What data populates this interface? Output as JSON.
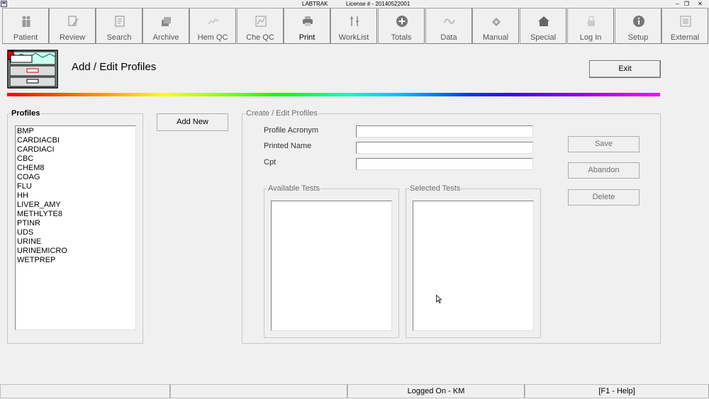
{
  "window": {
    "title": "LABTRAK",
    "license": "License # - 20140522001"
  },
  "toolbar": {
    "items": [
      {
        "label": "Patient",
        "icon": "patient-icon"
      },
      {
        "label": "Review",
        "icon": "review-icon"
      },
      {
        "label": "Search",
        "icon": "search-icon"
      },
      {
        "label": "Archive",
        "icon": "archive-icon"
      },
      {
        "label": "Hem QC",
        "icon": "chart-icon"
      },
      {
        "label": "Che QC",
        "icon": "chart-icon"
      },
      {
        "label": "Print",
        "icon": "printer-icon"
      },
      {
        "label": "WorkList",
        "icon": "worklist-icon"
      },
      {
        "label": "Totals",
        "icon": "plus-icon"
      },
      {
        "label": "Data",
        "icon": "data-icon"
      },
      {
        "label": "Manual",
        "icon": "manual-icon"
      },
      {
        "label": "Special",
        "icon": "special-icon"
      },
      {
        "label": "Log In",
        "icon": "lock-icon"
      },
      {
        "label": "Setup",
        "icon": "info-icon"
      },
      {
        "label": "External",
        "icon": "external-icon"
      }
    ]
  },
  "header": {
    "title": "Add / Edit Profiles",
    "exit_label": "Exit"
  },
  "profiles": {
    "group_label": "Profiles",
    "add_new_label": "Add New",
    "items": [
      "BMP",
      "CARDIACBI",
      "CARDIACI",
      "CBC",
      "CHEM8",
      "COAG",
      "FLU",
      "HH",
      "LIVER_AMY",
      "METHLYTE8",
      "PTINR",
      "UDS",
      "URINE",
      "URINEMICRO",
      "WETPREP"
    ]
  },
  "editor": {
    "group_label": "Create / Edit Profiles",
    "acronym_label": "Profile Acronym",
    "acronym_value": "",
    "printed_name_label": "Printed Name",
    "printed_name_value": "",
    "cpt_label": "Cpt",
    "cpt_value": "",
    "available_tests_label": "Available Tests",
    "selected_tests_label": "Selected Tests",
    "save_label": "Save",
    "abandon_label": "Abandon",
    "delete_label": "Delete"
  },
  "status": {
    "logged_on": "Logged On - KM",
    "help": "[F1 - Help]"
  },
  "colors": {
    "background": "#f0f0f0",
    "disabled_text": "#6d6d6d"
  }
}
